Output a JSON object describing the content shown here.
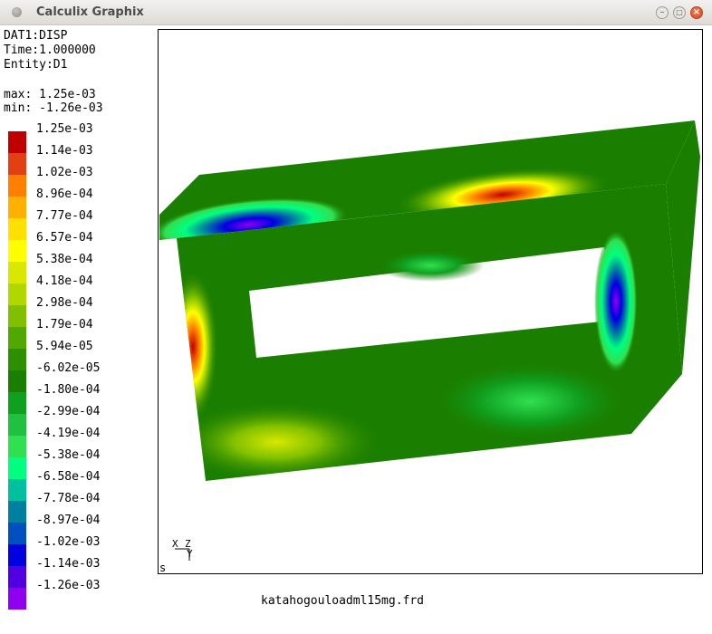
{
  "window": {
    "title": "Calculix Graphix"
  },
  "info": {
    "dataset": "DAT1:DISP",
    "time": "Time:1.000000",
    "entity": "Entity:D1",
    "max": "max: 1.25e-03",
    "min": "min: -1.26e-03"
  },
  "legend": [
    {
      "label": "1.25e-03",
      "color": "#c00000"
    },
    {
      "label": "1.14e-03",
      "color": "#e24012"
    },
    {
      "label": "1.02e-03",
      "color": "#ff8000"
    },
    {
      "label": "8.96e-04",
      "color": "#ffb000"
    },
    {
      "label": "7.77e-04",
      "color": "#ffe000"
    },
    {
      "label": "6.57e-04",
      "color": "#ffff00"
    },
    {
      "label": "5.38e-04",
      "color": "#d8e800"
    },
    {
      "label": "4.18e-04",
      "color": "#b0d800"
    },
    {
      "label": "2.98e-04",
      "color": "#80c000"
    },
    {
      "label": "1.79e-04",
      "color": "#50a800"
    },
    {
      "label": "5.94e-05",
      "color": "#2c9000"
    },
    {
      "label": "-6.02e-05",
      "color": "#1a7e00"
    },
    {
      "label": "-1.80e-04",
      "color": "#10a020"
    },
    {
      "label": "-2.99e-04",
      "color": "#20c040"
    },
    {
      "label": "-4.19e-04",
      "color": "#30e050"
    },
    {
      "label": "-5.38e-04",
      "color": "#00ff80"
    },
    {
      "label": "-6.58e-04",
      "color": "#00c0a0"
    },
    {
      "label": "-7.78e-04",
      "color": "#0080a0"
    },
    {
      "label": "-8.97e-04",
      "color": "#0050c0"
    },
    {
      "label": "-1.02e-03",
      "color": "#0000e0"
    },
    {
      "label": "-1.14e-03",
      "color": "#5000e0"
    },
    {
      "label": "-1.26e-03",
      "color": "#9000f0"
    }
  ],
  "axes": {
    "x": "X",
    "z": "Z",
    "y": "Y"
  },
  "viewport_label": "s",
  "filename": "katahogouloadml15mg.frd"
}
